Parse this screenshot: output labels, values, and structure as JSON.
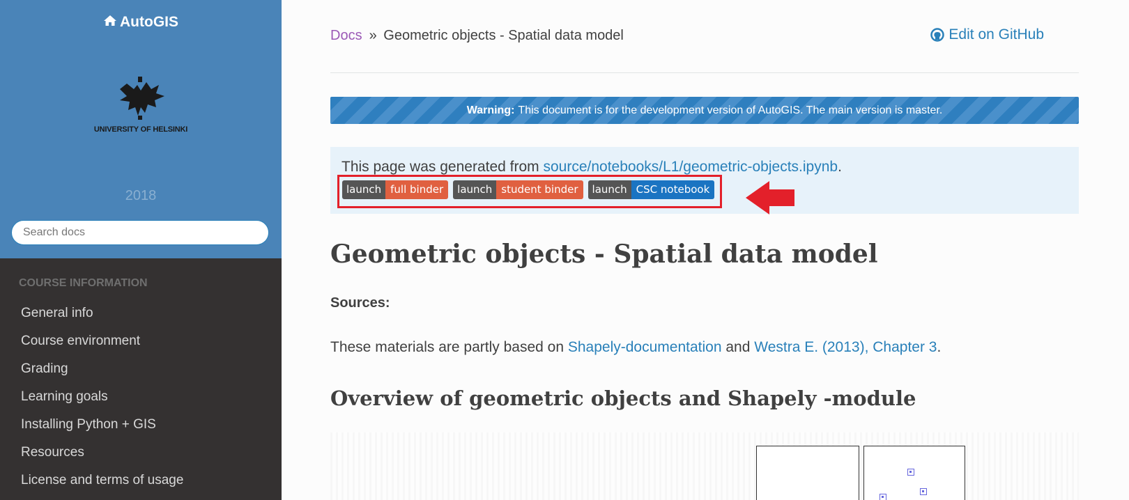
{
  "sidebar": {
    "brand": "AutoGIS",
    "logo_text": "UNIVERSITY OF HELSINKI",
    "version": "2018",
    "search_placeholder": "Search docs",
    "caption": "COURSE INFORMATION",
    "items": [
      {
        "label": "General info"
      },
      {
        "label": "Course environment"
      },
      {
        "label": "Grading"
      },
      {
        "label": "Learning goals"
      },
      {
        "label": "Installing Python + GIS"
      },
      {
        "label": "Resources"
      },
      {
        "label": "License and terms of usage"
      }
    ]
  },
  "header": {
    "crumb_root": "Docs",
    "crumb_sep": "»",
    "crumb_current": "Geometric objects - Spatial data model",
    "github": "Edit on GitHub"
  },
  "warning": {
    "label": "Warning:",
    "text": "This document is for the development version of AutoGIS. The main version is master."
  },
  "notebook": {
    "generated_prefix": "This page was generated from",
    "source_link": "source/notebooks/L1/geometric-objects.ipynb",
    "suffix": ".",
    "badges": [
      {
        "left": "launch",
        "right": "full binder"
      },
      {
        "left": "launch",
        "right": "student binder"
      },
      {
        "left": "launch",
        "right": "CSC notebook"
      }
    ]
  },
  "content": {
    "title": "Geometric objects - Spatial data model",
    "sources_label": "Sources:",
    "para_prefix": "These materials are partly based on",
    "link1": "Shapely-documentation",
    "para_mid": "and",
    "link2": "Westra E. (2013), Chapter 3",
    "para_suffix": ".",
    "h2": "Overview of geometric objects and Shapely -module"
  },
  "colors": {
    "sidebar_top": "#4a84b8",
    "sidebar_bg": "#343131",
    "link": "#2980b9",
    "crumb_link": "#9b59b6",
    "highlight": "#e3202a"
  }
}
